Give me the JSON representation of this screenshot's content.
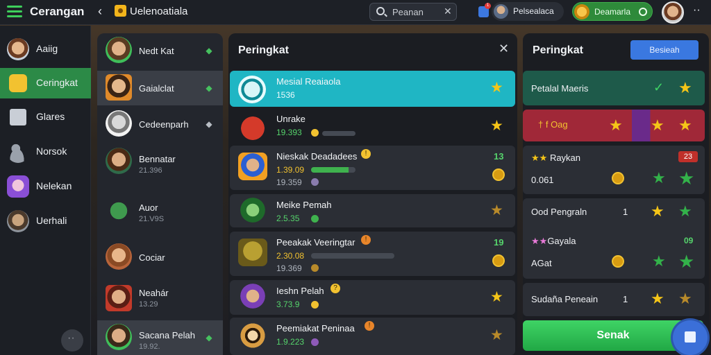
{
  "app": {
    "title": "Cerangan",
    "breadcrumb": "Uelenoatiala",
    "back_icon": "chevron-left-icon"
  },
  "search": {
    "placeholder": "Peanan",
    "value": ""
  },
  "header": {
    "notification_badge": "1",
    "user_name": "Pelsealaca",
    "coin_label": "Deamarla"
  },
  "sidebar": {
    "items": [
      {
        "label": "Aaiig",
        "icon": "avatar-icon",
        "active": false
      },
      {
        "label": "Ceringkat",
        "icon": "star-icon",
        "active": true
      },
      {
        "label": "Glares",
        "icon": "flag-icon",
        "active": false
      },
      {
        "label": "Norsok",
        "icon": "people-icon",
        "active": false
      },
      {
        "label": "Nelekan",
        "icon": "character-icon",
        "active": false
      },
      {
        "label": "Uerhali",
        "icon": "avatar-icon",
        "active": false
      }
    ]
  },
  "friends": [
    {
      "name": "Nedt Kat",
      "sub": "",
      "status": "online"
    },
    {
      "name": "Gaialclat",
      "sub": "",
      "status": "online"
    },
    {
      "name": "Cedeenparh",
      "sub": "",
      "status": "neutral"
    },
    {
      "name": "Bennatar",
      "sub": "21.396",
      "status": ""
    },
    {
      "name": "Auor",
      "sub": "21.V9S",
      "status": ""
    },
    {
      "name": "Cociar",
      "sub": "",
      "status": ""
    },
    {
      "name": "Neahár",
      "sub": "13.29",
      "status": ""
    },
    {
      "name": "Sacana Pelah",
      "sub": "19.92.",
      "status": "online"
    }
  ],
  "ranking": {
    "title": "Peringkat",
    "close_icon": "close-icon",
    "rows": [
      {
        "name": "Mesial Reaiaola",
        "score": "1536",
        "progress": null,
        "star": "gold",
        "highlight": true
      },
      {
        "name": "Unrake",
        "score": "19.393",
        "progress": 0.0,
        "star": "gold"
      },
      {
        "name": "Nieskak Deadadees",
        "score": "1.39.09",
        "score2": "19.359",
        "progress": 0.85,
        "rank": "13",
        "badge": "!"
      },
      {
        "name": "Meike Pemah",
        "score": "2.5.35",
        "progress": 0.0,
        "star": "dim"
      },
      {
        "name": "Peeakak Veeringtar",
        "score": "2.30.08",
        "score2": "19.369",
        "progress": 0.0,
        "rank": "19",
        "badge": "!"
      },
      {
        "name": "Ieshn Pelah",
        "score": "3.73.9",
        "progress": 0.0,
        "star": "gold",
        "badge": "?"
      },
      {
        "name": "Peemiakat Peninaa",
        "score": "1.9.223",
        "progress": 0.0,
        "star": "dim"
      }
    ]
  },
  "right": {
    "title": "Peringkat",
    "action_label": "Besieah",
    "cards": [
      {
        "label": "Petalal Maeris"
      },
      {
        "label": "f Oag"
      },
      {
        "label": "Raykan",
        "value": "0.061",
        "badge": "23"
      },
      {
        "label": "Ood Pengraln",
        "value": "1"
      },
      {
        "label": "Gayala",
        "value": "AGat",
        "rank": "09"
      },
      {
        "label": "Sudaña Peneain",
        "value": "1"
      }
    ],
    "primary_label": "Senak"
  }
}
